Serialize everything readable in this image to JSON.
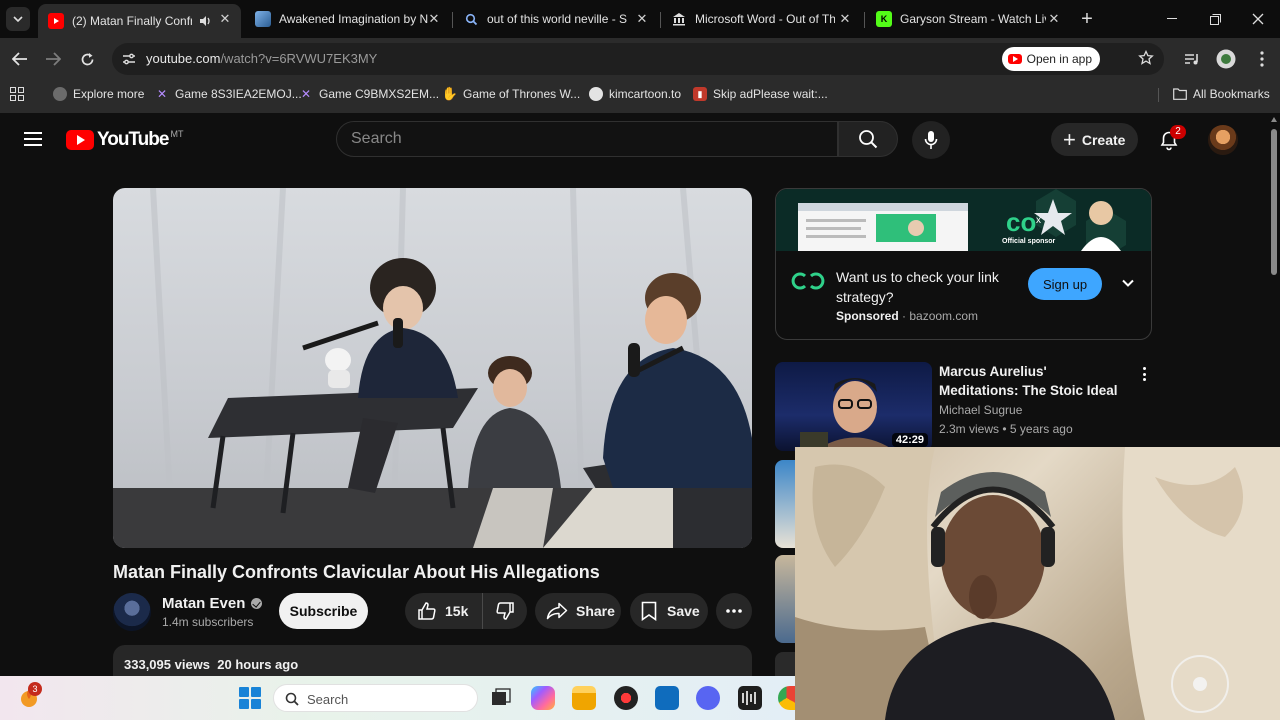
{
  "browser": {
    "tabs": [
      {
        "title": "(2) Matan Finally Confronts",
        "active": true
      },
      {
        "title": "Awakened Imagination by N",
        "active": false
      },
      {
        "title": "out of this world neville - Se",
        "active": false
      },
      {
        "title": "Microsoft Word - Out of Thi",
        "active": false
      },
      {
        "title": "Garyson Stream - Watch Live",
        "active": false
      }
    ],
    "new_tab_label": "+",
    "address": {
      "host": "youtube.com",
      "path": "/watch?v=6RVWU7EK3MY"
    },
    "open_in_app_label": "Open in app",
    "bookmarks": [
      {
        "label": "Explore more"
      },
      {
        "label": "Game 8S3IEA2EMOJ..."
      },
      {
        "label": "Game C9BMXS2EM..."
      },
      {
        "label": "Game of Thrones W..."
      },
      {
        "label": "kimcartoon.to"
      },
      {
        "label": "Skip adPlease wait:..."
      }
    ],
    "all_bookmarks_label": "All Bookmarks"
  },
  "youtube": {
    "logo_text": "YouTube",
    "region_code": "MT",
    "search_placeholder": "Search",
    "create_label": "Create",
    "notification_count": "2",
    "video": {
      "title": "Matan Finally Confronts Clavicular About His Allegations",
      "channel": "Matan Even",
      "subscribers": "1.4m subscribers",
      "subscribe_label": "Subscribe",
      "likes": "15k",
      "share_label": "Share",
      "save_label": "Save",
      "views": "333,095 views",
      "posted": "20 hours ago"
    },
    "ad": {
      "title": "Want us to check your link strategy?",
      "sponsored": "Sponsored",
      "domain": "bazoom.com",
      "cta": "Sign up",
      "banner_caption": "Official sponsor"
    },
    "recommendations": [
      {
        "title": "Marcus Aurelius' Meditations: The Stoic Ideal",
        "channel": "Michael Sugrue",
        "views": "2.3m views",
        "age": "5 years ago",
        "duration": "42:29"
      }
    ]
  },
  "taskbar": {
    "weather_badge": "3",
    "search_label": "Search"
  },
  "colors": {
    "yt_red": "#ff0000",
    "background": "#0f0f0f",
    "signup_blue": "#3ea6ff",
    "ad_green": "#2fd18a"
  }
}
